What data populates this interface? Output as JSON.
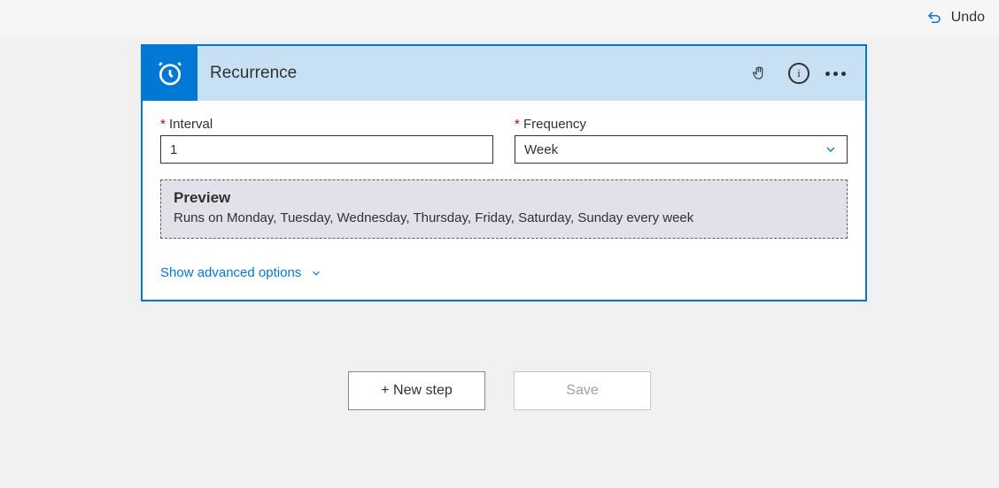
{
  "topbar": {
    "undo_label": "Undo"
  },
  "card": {
    "title": "Recurrence",
    "fields": {
      "interval": {
        "label": "Interval",
        "value": "1"
      },
      "frequency": {
        "label": "Frequency",
        "value": "Week"
      }
    },
    "preview": {
      "title": "Preview",
      "text": "Runs on Monday, Tuesday, Wednesday, Thursday, Friday, Saturday, Sunday every week"
    },
    "advanced_label": "Show advanced options"
  },
  "buttons": {
    "new_step": "+ New step",
    "save": "Save"
  }
}
